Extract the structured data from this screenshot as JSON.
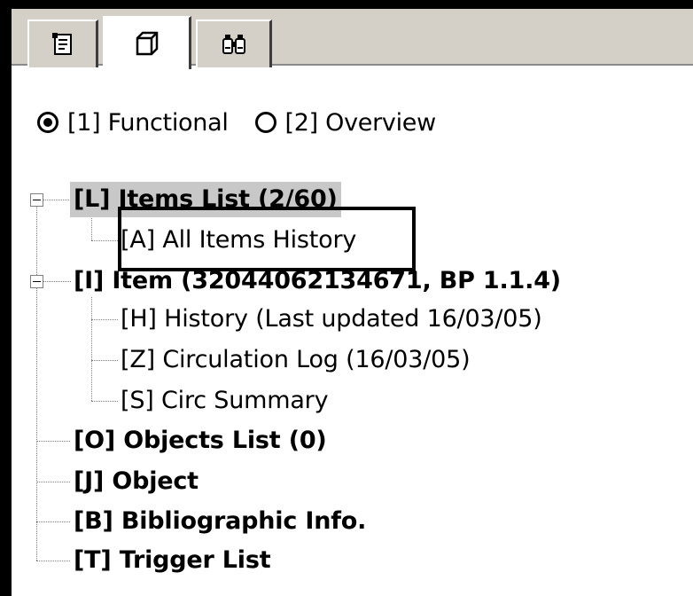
{
  "tabs": [
    {
      "icon": "properties-sheet-icon",
      "active": false
    },
    {
      "icon": "cube-icon",
      "active": true
    },
    {
      "icon": "binoculars-icon",
      "active": false
    }
  ],
  "view_mode": {
    "options": [
      {
        "label": "[1] Functional",
        "selected": true
      },
      {
        "label": "[2] Overview",
        "selected": false
      }
    ]
  },
  "tree": {
    "nodes": [
      {
        "label": "[L] Items List (2/60)",
        "bold": true,
        "expanded": true,
        "selected": true
      },
      {
        "label": "[A] All Items History",
        "bold": false
      },
      {
        "label": "[I] Item (32044062134671, BP 1.1.4)",
        "bold": true,
        "expanded": true
      },
      {
        "label": "[H] History (Last updated 16/03/05)",
        "bold": false
      },
      {
        "label": "[Z] Circulation Log (16/03/05)",
        "bold": false
      },
      {
        "label": "[S] Circ Summary",
        "bold": false
      },
      {
        "label": "[O] Objects List (0)",
        "bold": true
      },
      {
        "label": "[J] Object",
        "bold": true
      },
      {
        "label": "[B] Bibliographic Info.",
        "bold": true
      },
      {
        "label": "[T] Trigger List",
        "bold": true
      }
    ]
  }
}
